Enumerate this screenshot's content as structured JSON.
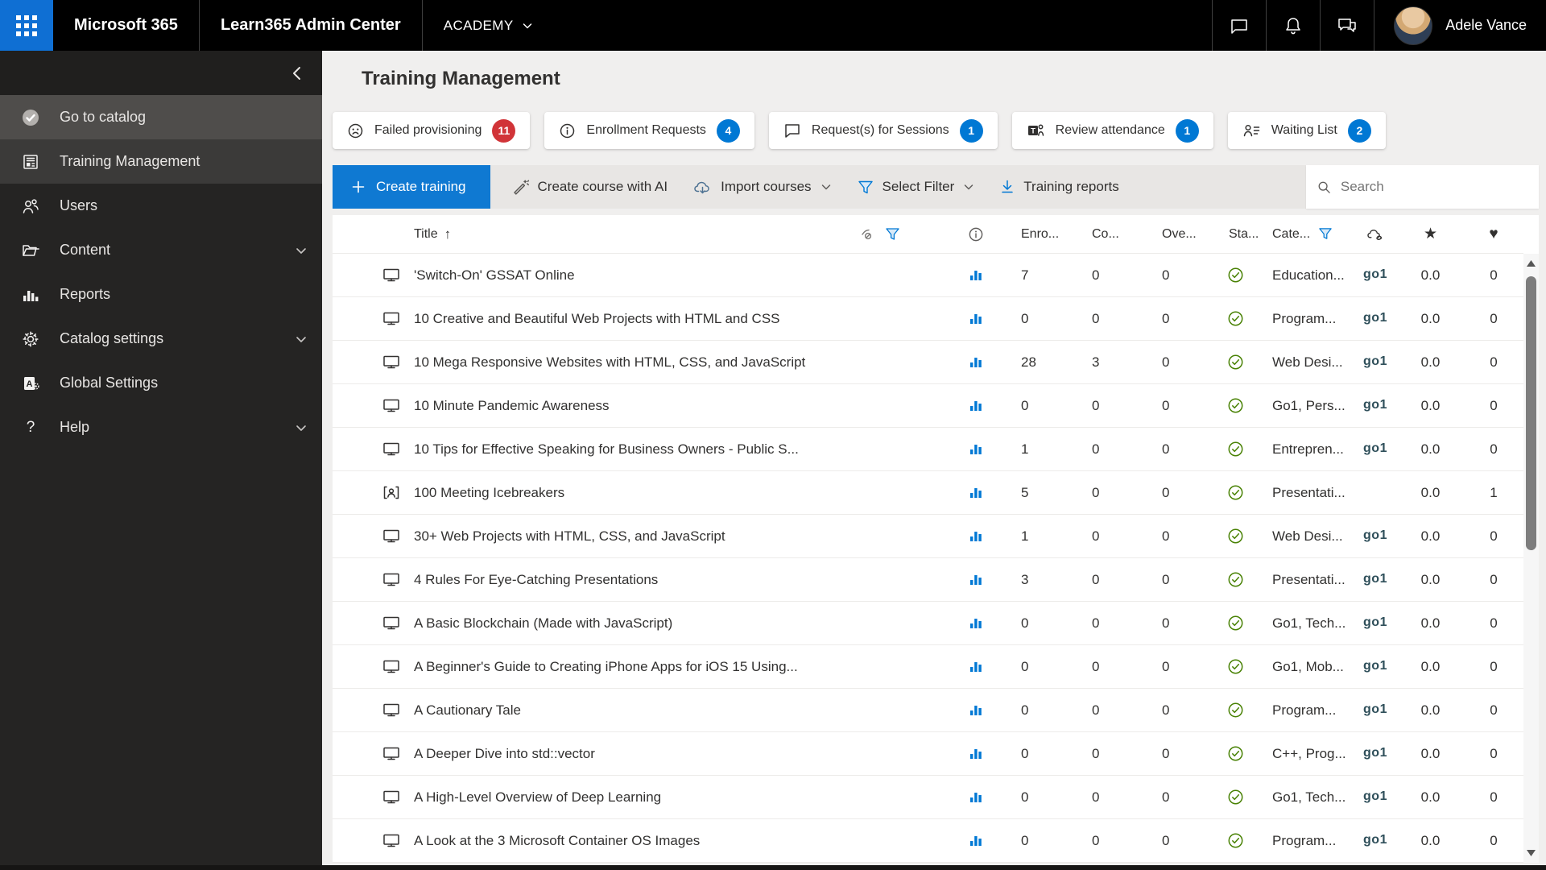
{
  "topbar": {
    "brand": "Microsoft 365",
    "app_title": "Learn365 Admin Center",
    "tenant": "ACADEMY",
    "user_name": "Adele Vance"
  },
  "sidebar": {
    "items": [
      {
        "label": "Go to catalog",
        "state": "highlight",
        "expandable": false
      },
      {
        "label": "Training Management",
        "state": "selected",
        "expandable": false
      },
      {
        "label": "Users",
        "state": "",
        "expandable": false
      },
      {
        "label": "Content",
        "state": "",
        "expandable": true
      },
      {
        "label": "Reports",
        "state": "",
        "expandable": false
      },
      {
        "label": "Catalog settings",
        "state": "",
        "expandable": true
      },
      {
        "label": "Global Settings",
        "state": "",
        "expandable": false
      },
      {
        "label": "Help",
        "state": "",
        "expandable": true
      }
    ]
  },
  "page": {
    "title": "Training Management"
  },
  "notice_buttons": [
    {
      "label": "Failed provisioning",
      "count": "11",
      "badge_color": "#d13438",
      "icon": "sad-face-icon"
    },
    {
      "label": "Enrollment Requests",
      "count": "4",
      "badge_color": "#0078d4",
      "icon": "info-icon"
    },
    {
      "label": "Request(s) for Sessions",
      "count": "1",
      "badge_color": "#0078d4",
      "icon": "chat-bubble-icon"
    },
    {
      "label": "Review attendance",
      "count": "1",
      "badge_color": "#0078d4",
      "icon": "teams-icon"
    },
    {
      "label": "Waiting List",
      "count": "2",
      "badge_color": "#0078d4",
      "icon": "people-list-icon"
    }
  ],
  "toolbar": {
    "create_training": "Create training",
    "create_course_ai": "Create course with AI",
    "import_courses": "Import courses",
    "select_filter": "Select Filter",
    "training_reports": "Training reports",
    "search_placeholder": "Search"
  },
  "table": {
    "columns": {
      "title": "Title",
      "enrolled": "Enro...",
      "completed": "Co...",
      "overdue": "Ove...",
      "status": "Sta...",
      "category": "Cate..."
    },
    "header_icons": [
      "visibility-filter-icon",
      "info-circle-icon",
      "category-filter-icon",
      "cloud-sync-icon",
      "star-icon",
      "heart-icon"
    ],
    "star_glyph": "★",
    "heart_glyph": "♥",
    "sort_glyph": "↑",
    "rows": [
      {
        "type": "course",
        "title": "'Switch-On' GSSAT Online",
        "enrolled": "7",
        "completed": "0",
        "overdue": "0",
        "category": "Education...",
        "provider": "go1",
        "rating": "0.0",
        "likes": "0"
      },
      {
        "type": "course",
        "title": "10 Creative and Beautiful Web Projects with HTML and CSS",
        "enrolled": "0",
        "completed": "0",
        "overdue": "0",
        "category": "Program...",
        "provider": "go1",
        "rating": "0.0",
        "likes": "0"
      },
      {
        "type": "course",
        "title": "10 Mega Responsive Websites with HTML, CSS, and JavaScript",
        "enrolled": "28",
        "completed": "3",
        "overdue": "0",
        "category": "Web Desi...",
        "provider": "go1",
        "rating": "0.0",
        "likes": "0"
      },
      {
        "type": "course",
        "title": "10 Minute Pandemic Awareness",
        "enrolled": "0",
        "completed": "0",
        "overdue": "0",
        "category": "Go1, Pers...",
        "provider": "go1",
        "rating": "0.0",
        "likes": "0"
      },
      {
        "type": "course",
        "title": "10 Tips for Effective Speaking for Business Owners - Public S...",
        "enrolled": "1",
        "completed": "0",
        "overdue": "0",
        "category": "Entrepren...",
        "provider": "go1",
        "rating": "0.0",
        "likes": "0"
      },
      {
        "type": "plan",
        "title": "100 Meeting Icebreakers",
        "enrolled": "5",
        "completed": "0",
        "overdue": "0",
        "category": "Presentati...",
        "provider": "",
        "rating": "0.0",
        "likes": "1"
      },
      {
        "type": "course",
        "title": "30+ Web Projects with HTML, CSS, and JavaScript",
        "enrolled": "1",
        "completed": "0",
        "overdue": "0",
        "category": "Web Desi...",
        "provider": "go1",
        "rating": "0.0",
        "likes": "0"
      },
      {
        "type": "course",
        "title": "4 Rules For Eye-Catching Presentations",
        "enrolled": "3",
        "completed": "0",
        "overdue": "0",
        "category": "Presentati...",
        "provider": "go1",
        "rating": "0.0",
        "likes": "0"
      },
      {
        "type": "course",
        "title": "A Basic Blockchain (Made with JavaScript)",
        "enrolled": "0",
        "completed": "0",
        "overdue": "0",
        "category": "Go1, Tech...",
        "provider": "go1",
        "rating": "0.0",
        "likes": "0"
      },
      {
        "type": "course",
        "title": "A Beginner's Guide to Creating iPhone Apps for iOS 15 Using...",
        "enrolled": "0",
        "completed": "0",
        "overdue": "0",
        "category": "Go1, Mob...",
        "provider": "go1",
        "rating": "0.0",
        "likes": "0"
      },
      {
        "type": "course",
        "title": "A Cautionary Tale",
        "enrolled": "0",
        "completed": "0",
        "overdue": "0",
        "category": "Program...",
        "provider": "go1",
        "rating": "0.0",
        "likes": "0"
      },
      {
        "type": "course",
        "title": "A Deeper Dive into std::vector",
        "enrolled": "0",
        "completed": "0",
        "overdue": "0",
        "category": "C++, Prog...",
        "provider": "go1",
        "rating": "0.0",
        "likes": "0"
      },
      {
        "type": "course",
        "title": "A High-Level Overview of Deep Learning",
        "enrolled": "0",
        "completed": "0",
        "overdue": "0",
        "category": "Go1, Tech...",
        "provider": "go1",
        "rating": "0.0",
        "likes": "0"
      },
      {
        "type": "course",
        "title": "A Look at the 3 Microsoft Container OS Images",
        "enrolled": "0",
        "completed": "0",
        "overdue": "0",
        "category": "Program...",
        "provider": "go1",
        "rating": "0.0",
        "likes": "0"
      }
    ]
  }
}
